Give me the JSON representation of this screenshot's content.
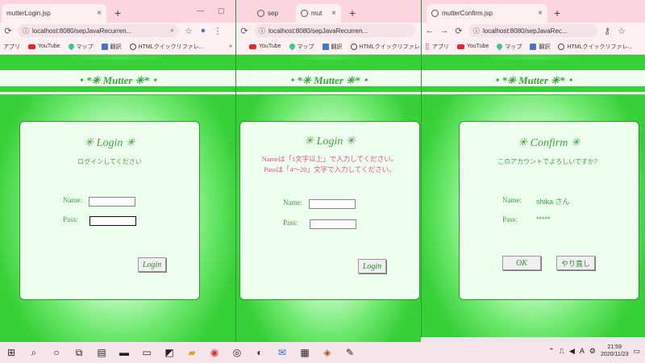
{
  "windows": [
    {
      "tabs": [
        {
          "title": "mutterLogin.jsp"
        }
      ],
      "url": "localhost:8080/sepJavaRecurren...",
      "bookmarks": [
        "アプリ",
        "YouTube",
        "マップ",
        "翻訳",
        "HTMLクイックリファレ...",
        "»"
      ],
      "header": "・*✳ Mutter ✳*・",
      "card": {
        "title": "✳ Login ✳",
        "subtitle": "ログインしてください",
        "name_label": "Name:",
        "pass_label": "Pass:",
        "button": "Login"
      }
    },
    {
      "tabs": [
        {
          "title": "sep"
        },
        {
          "title": "mut"
        }
      ],
      "url": "localhost:8080/sepJavaRecurren...",
      "bookmarks": [
        "YouTube",
        "マップ",
        "翻訳",
        "HTMLクイックリファレ..."
      ],
      "header": "・*✳ Mutter ✳*・",
      "card": {
        "title": "✳ Login ✳",
        "errors": [
          "Nameは「1文字以上」で入力してください。",
          "Passは「4〜20」文字で入力してください。"
        ],
        "name_label": "Name:",
        "pass_label": "Pass:",
        "button": "Login"
      }
    },
    {
      "tabs": [
        {
          "title": "mutterConfirm.jsp"
        }
      ],
      "url": "localhost:8080/sepJavaRec...",
      "bookmarks": [
        "アプリ",
        "YouTube",
        "マップ",
        "翻訳",
        "HTMLクイックリファレ..."
      ],
      "header": "・*✳ Mutter ✳*・",
      "card": {
        "title": "✳ Confirm ✳",
        "subtitle": "このアカウントでよろしいですか？",
        "name_label": "Name:",
        "name_value": "shika さん",
        "pass_label": "Pass:",
        "pass_value": "*****",
        "ok_button": "OK",
        "redo_button": "やり直し"
      }
    }
  ],
  "taskbar": {
    "time": "21:59",
    "date": "2020/11/23"
  },
  "colors": {
    "page_green": "#38d038",
    "title_green": "#3aa63a",
    "error_pink": "#e04a8a",
    "tabbar_pink": "#fbd6e0"
  }
}
